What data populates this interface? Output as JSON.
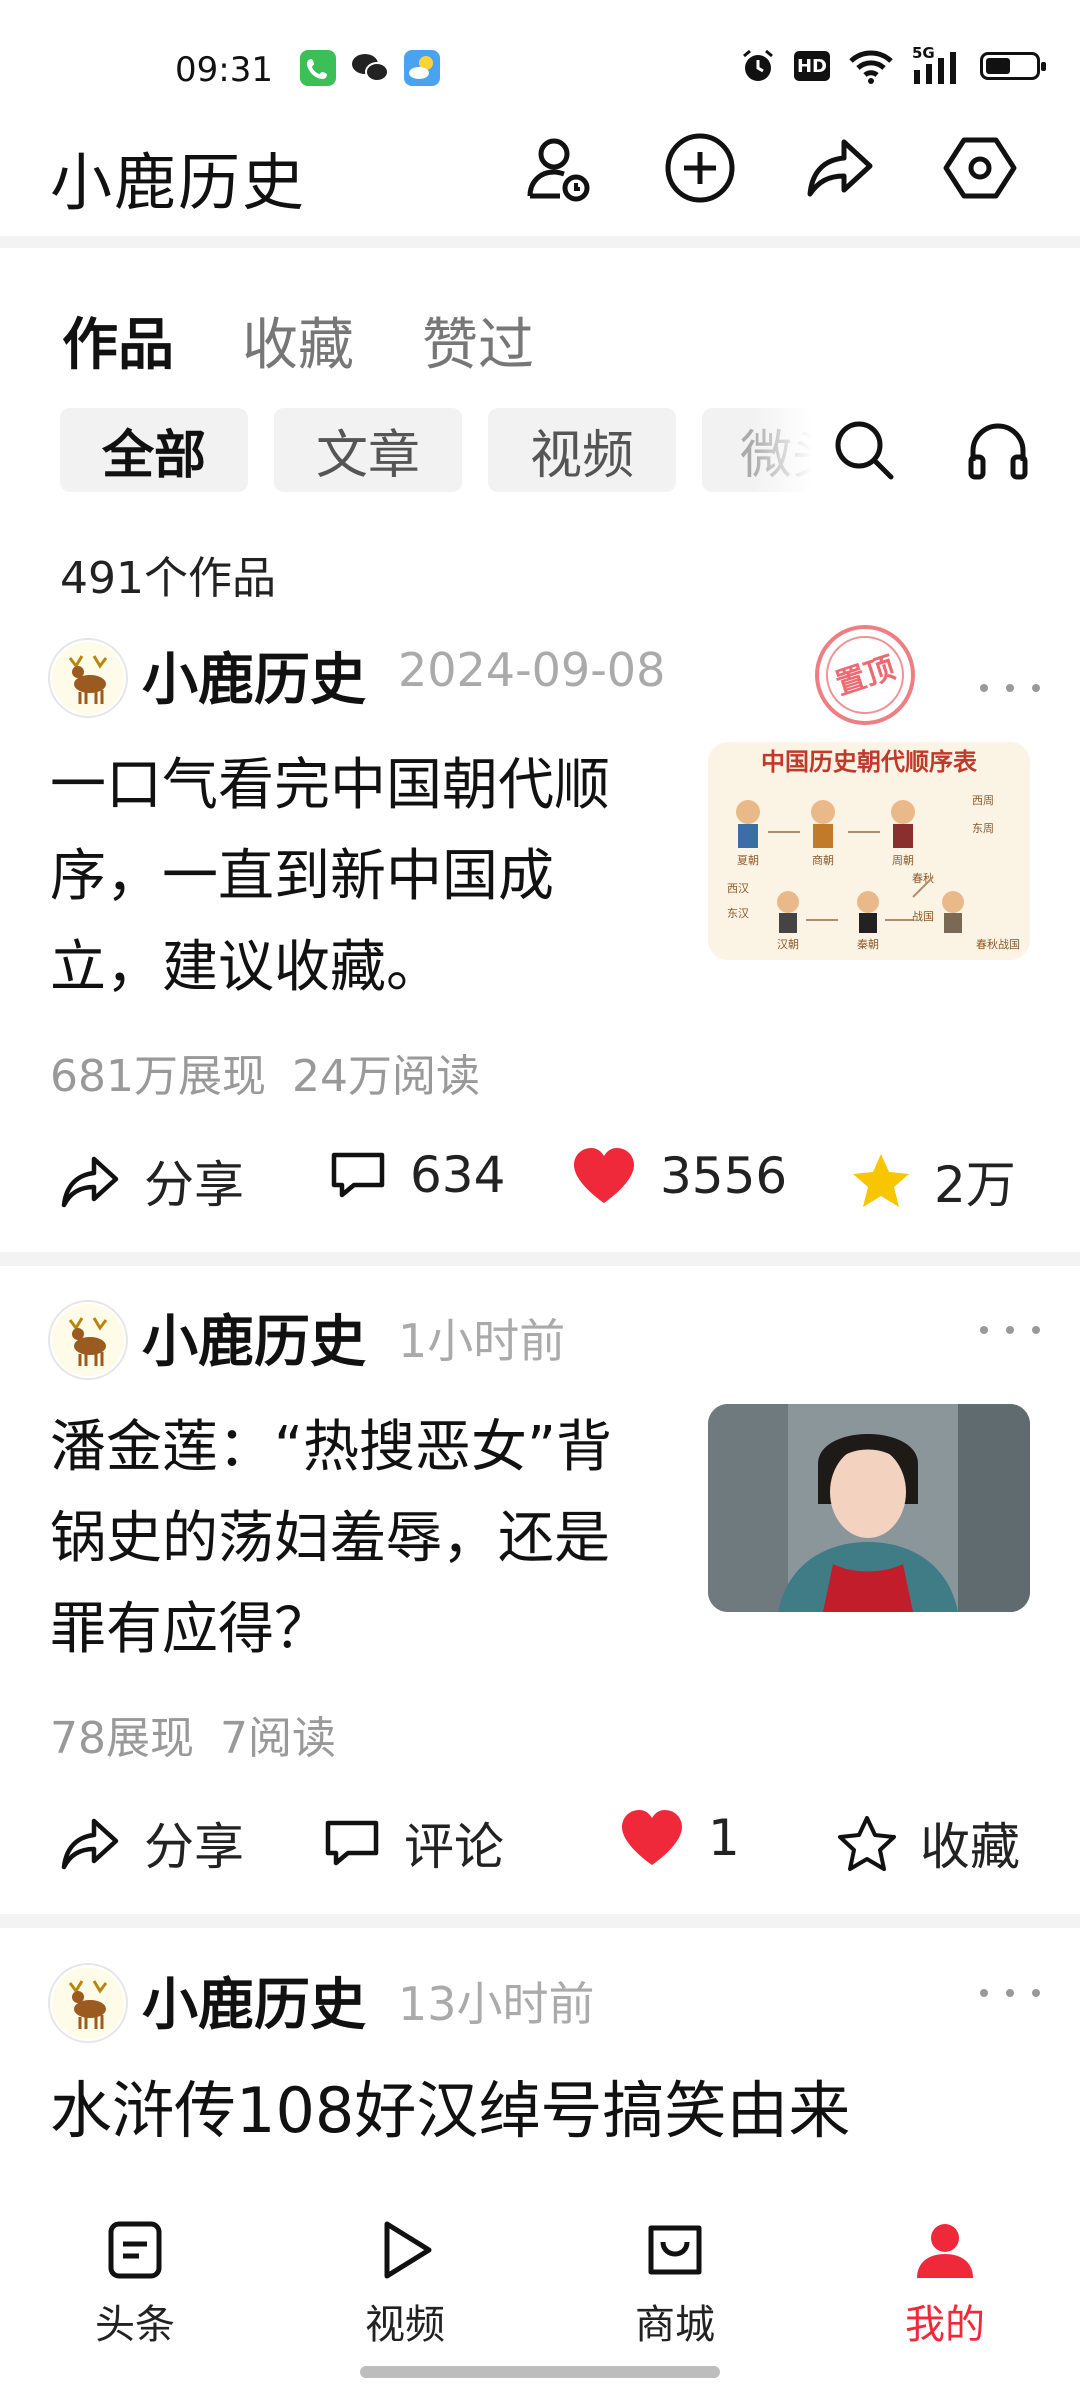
{
  "status_bar": {
    "time": "09:31",
    "network": "5G"
  },
  "header": {
    "title": "小鹿历史"
  },
  "tabs": [
    "作品",
    "收藏",
    "赞过"
  ],
  "filters": [
    "全部",
    "文章",
    "视频",
    "微头条"
  ],
  "works_count": "491个作品",
  "posts": [
    {
      "author": "小鹿历史",
      "time": "2024-09-08",
      "pinned_badge": "置顶",
      "title_lines": [
        "一口气看完中国朝代顺",
        "序，一直到新中国成",
        "立，建议收藏。"
      ],
      "impressions": "681万展现",
      "reads": "24万阅读",
      "actions": {
        "share": "分享",
        "comment": "634",
        "like": "3556",
        "favorite": "2万"
      },
      "thumb_title": "中国历史朝代顺序表",
      "thumb_labels": [
        "夏朝",
        "商朝",
        "周朝",
        "西周",
        "东周",
        "西汉",
        "东汉",
        "汉朝",
        "秦朝",
        "春秋",
        "战国",
        "春秋战国"
      ]
    },
    {
      "author": "小鹿历史",
      "time": "1小时前",
      "title_lines": [
        "潘金莲：“热搜恶女”背",
        "锅史的荡妇羞辱，还是",
        "罪有应得？"
      ],
      "impressions": "78展现",
      "reads": "7阅读",
      "actions": {
        "share": "分享",
        "comment": "评论",
        "like": "1",
        "favorite": "收藏"
      }
    },
    {
      "author": "小鹿历史",
      "time": "13小时前",
      "title_lines": [
        "水浒传108好汉绰号搞笑由来"
      ]
    }
  ],
  "bottom_nav": [
    "头条",
    "视频",
    "商城",
    "我的"
  ],
  "colors": {
    "accent": "#f0293a",
    "star": "#f7c600"
  }
}
